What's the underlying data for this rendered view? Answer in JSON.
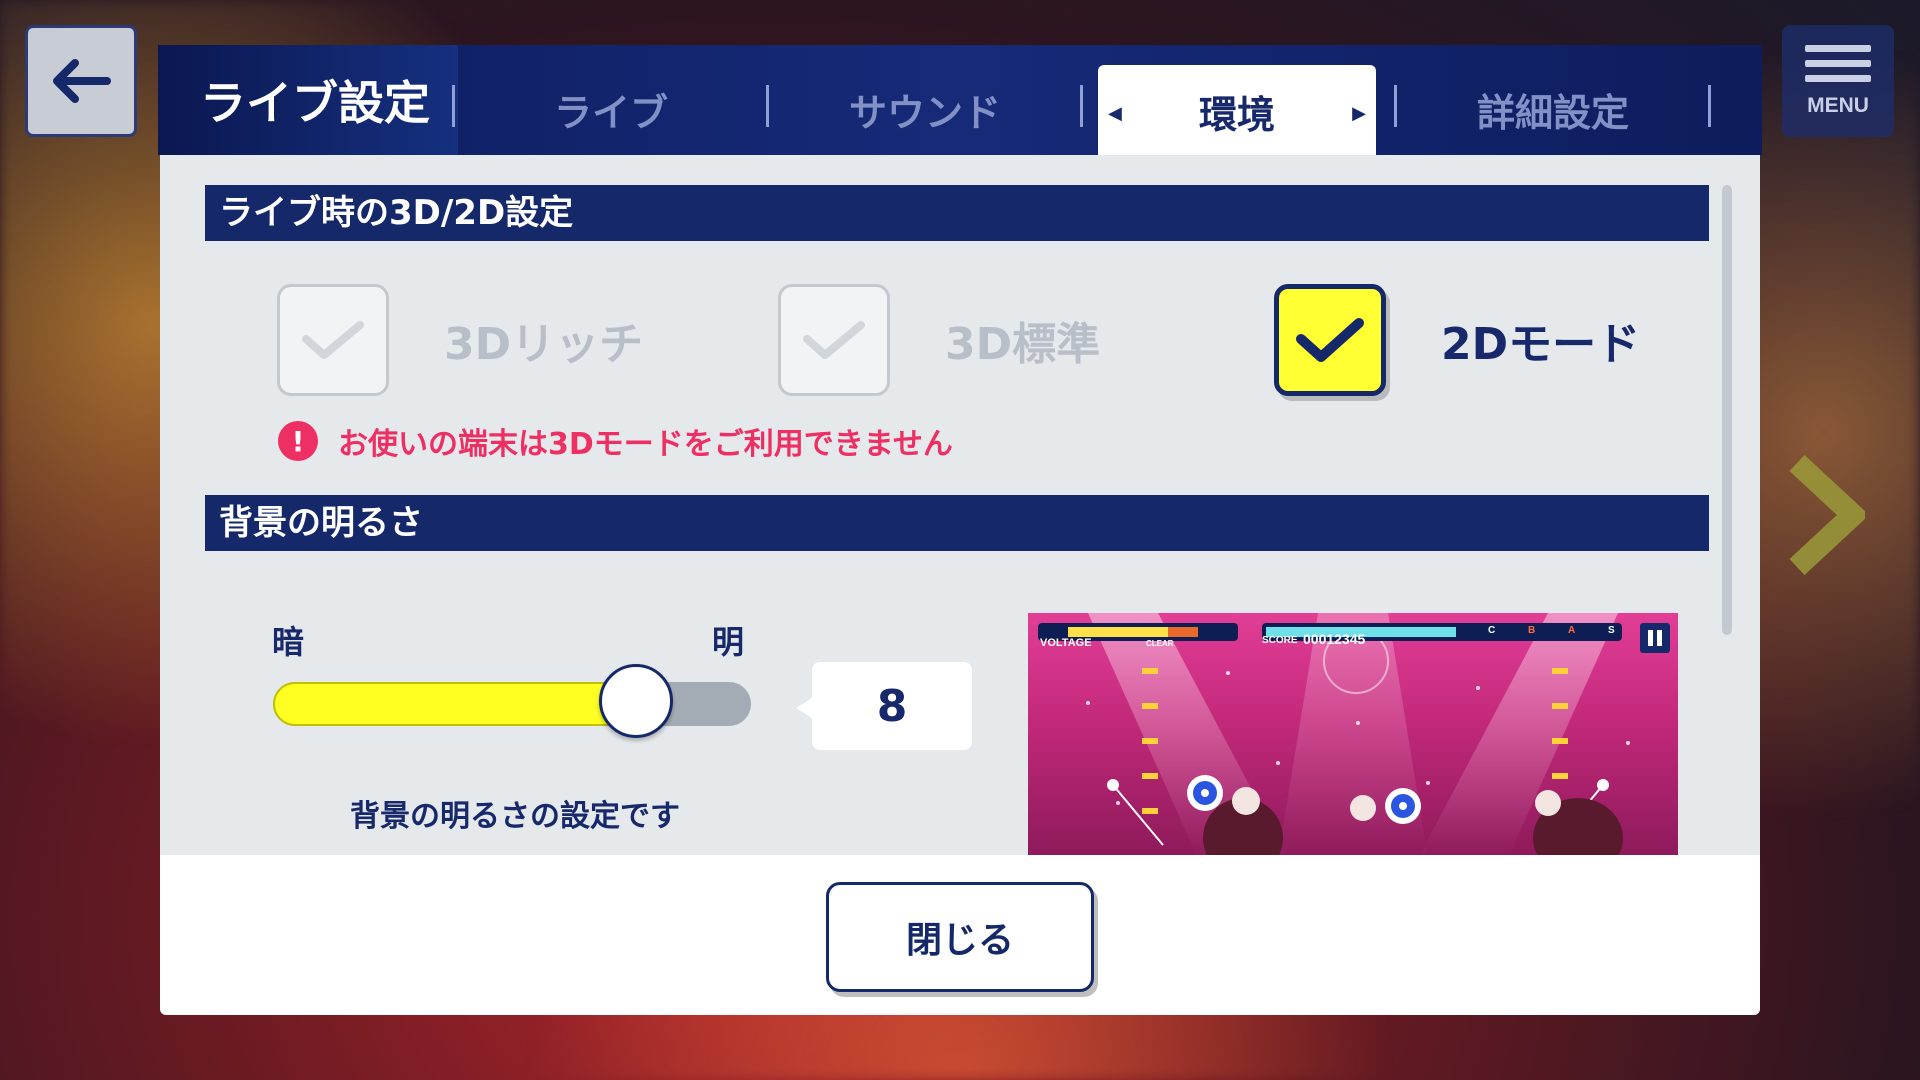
{
  "panel": {
    "title": "ライブ設定"
  },
  "tabs": [
    {
      "label": "ライブ"
    },
    {
      "label": "サウンド"
    },
    {
      "label": "環境"
    },
    {
      "label": "詳細設定"
    }
  ],
  "active_tab": "環境",
  "nav": {
    "menu_label": "MENU",
    "back_icon": "back-arrow-icon",
    "next_icon": "chevron-right-icon"
  },
  "section_3d2d": {
    "title": "ライブ時の3D/2D設定",
    "options": [
      {
        "label": "3Dリッチ",
        "checked": false,
        "enabled": false
      },
      {
        "label": "3D標準",
        "checked": false,
        "enabled": false
      },
      {
        "label": "2Dモード",
        "checked": true,
        "enabled": true
      }
    ],
    "warning": "お使いの端末は3Dモードをご利用できません"
  },
  "section_brightness": {
    "title": "背景の明るさ",
    "label_dark": "暗",
    "label_bright": "明",
    "value": "8",
    "level_fraction": 0.76,
    "description": "背景の明るさの設定です"
  },
  "preview_hud": {
    "voltage_label": "VOLTAGE",
    "clear_label": "CLEAR",
    "score_label": "SCORE",
    "score_value": "00012345",
    "rank_marks": [
      "C",
      "B",
      "A",
      "S"
    ]
  },
  "footer": {
    "close_label": "閉じる"
  },
  "colors": {
    "navy": "#15296a",
    "accent_yellow": "#ffff33",
    "warning": "#ee2f63"
  }
}
